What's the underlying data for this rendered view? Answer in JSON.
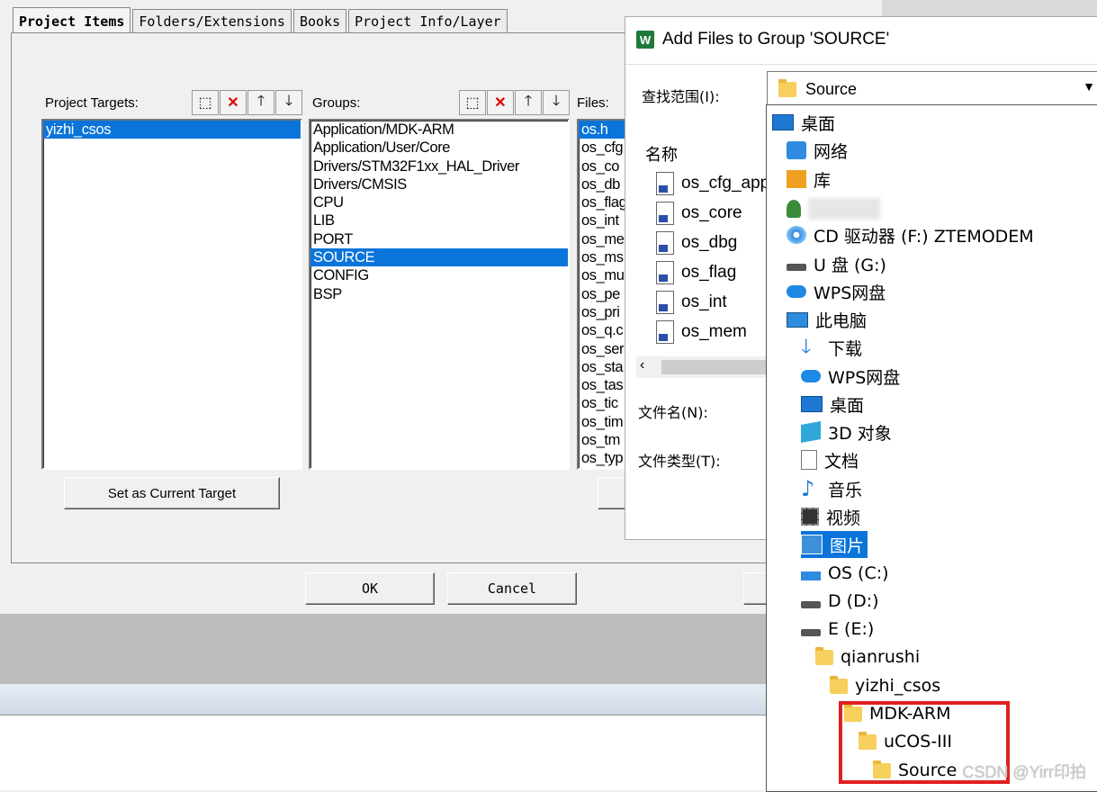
{
  "project_dialog": {
    "tabs": [
      "Project Items",
      "Folders/Extensions",
      "Books",
      "Project Info/Layer"
    ],
    "targets": {
      "label": "Project Targets:",
      "items": [
        "yizhi_csos"
      ],
      "selected": "yizhi_csos"
    },
    "groups": {
      "label": "Groups:",
      "items": [
        "Application/MDK-ARM",
        "Application/User/Core",
        "Drivers/STM32F1xx_HAL_Driver",
        "Drivers/CMSIS",
        "CPU",
        "LIB",
        "PORT",
        "SOURCE",
        "CONFIG",
        "BSP"
      ],
      "selected": "SOURCE"
    },
    "files": {
      "label": "Files:",
      "items": [
        "os.h",
        "os_cfg",
        "os_co",
        "os_db",
        "os_flag",
        "os_int",
        "os_me",
        "os_ms",
        "os_mu",
        "os_pe",
        "os_pri",
        "os_q.c",
        "os_ser",
        "os_sta",
        "os_tas",
        "os_tic",
        "os_tim",
        "os_tm",
        "os_typ"
      ],
      "selected": "os.h"
    },
    "set_target_button": "Set as Current Target",
    "ok_button": "OK",
    "cancel_button": "Cancel"
  },
  "add_files_dialog": {
    "title": "Add Files to Group 'SOURCE'",
    "icon_letter": "W",
    "look_in_label": "查找范围(I):",
    "look_in_value": "Source",
    "name_column": "名称",
    "files": [
      "os_cfg_app",
      "os_core",
      "os_dbg",
      "os_flag",
      "os_int",
      "os_mem"
    ],
    "filename_label": "文件名(N):",
    "filetype_label": "文件类型(T):"
  },
  "dropdown_items": [
    {
      "label": "桌面",
      "icon": "desktop-icon"
    },
    {
      "label": "网络",
      "icon": "network-icon"
    },
    {
      "label": "库",
      "icon": "library-icon"
    },
    {
      "label": "",
      "icon": "user-icon"
    },
    {
      "label": "CD 驱动器 (F:) ZTEMODEM",
      "icon": "cd-drive-icon"
    },
    {
      "label": "U 盘 (G:)",
      "icon": "usb-drive-icon"
    },
    {
      "label": "WPS网盘",
      "icon": "wps-cloud-icon"
    },
    {
      "label": "此电脑",
      "icon": "computer-icon"
    },
    {
      "label": "下载",
      "icon": "download-icon"
    },
    {
      "label": "WPS网盘",
      "icon": "wps-cloud-icon"
    },
    {
      "label": "桌面",
      "icon": "desktop-icon"
    },
    {
      "label": "3D 对象",
      "icon": "3d-objects-icon"
    },
    {
      "label": "文档",
      "icon": "documents-icon"
    },
    {
      "label": "音乐",
      "icon": "music-icon"
    },
    {
      "label": "视频",
      "icon": "video-icon"
    },
    {
      "label": "图片",
      "icon": "pictures-icon"
    },
    {
      "label": "OS (C:)",
      "icon": "os-drive-icon"
    },
    {
      "label": "D (D:)",
      "icon": "drive-icon"
    },
    {
      "label": "E (E:)",
      "icon": "drive-icon"
    },
    {
      "label": "qianrushi",
      "icon": "folder-icon"
    },
    {
      "label": "yizhi_csos",
      "icon": "folder-icon"
    },
    {
      "label": "MDK-ARM",
      "icon": "folder-icon"
    },
    {
      "label": "uCOS-III",
      "icon": "folder-icon"
    },
    {
      "label": "Source",
      "icon": "folder-icon"
    }
  ],
  "dropdown_selected": "图片",
  "watermark": "CSDN @Yirr印拍",
  "colors": {
    "selection": "#0a74da",
    "highlight_box": "#e02020",
    "folder": "#f7cf5c"
  }
}
